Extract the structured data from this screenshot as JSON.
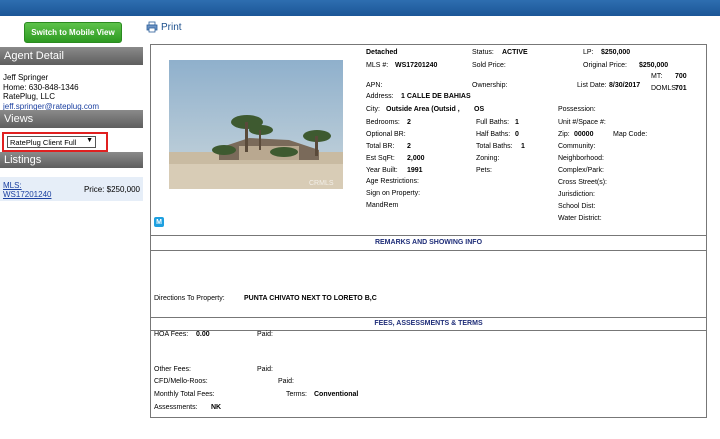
{
  "sidebar": {
    "mobile_button": "Switch to Mobile View",
    "agent_detail_title": "Agent Detail",
    "agent_name": "Jeff Springer",
    "agent_phone": "Home: 630-848-1346",
    "agent_company": "RatePlug, LLC",
    "agent_email": "jeff.springer@rateplug.com",
    "views_title": "Views",
    "views_selected": "RatePlug Client Full",
    "listings_title": "Listings",
    "listing_mls_label": "MLS:",
    "listing_mls": "WS17201240",
    "listing_price": "Price: $250,000"
  },
  "toolbar": {
    "print_label": "Print"
  },
  "listing": {
    "type": "Detached",
    "mls_label": "MLS #:",
    "mls": "WS17201240",
    "status_label": "Status:",
    "status": "ACTIVE",
    "lp_label": "LP:",
    "lp": "$250,000",
    "sold_price_label": "Sold Price:",
    "original_price_label": "Original Price:",
    "original_price": "$250,000",
    "mt_label": "MT:",
    "mt": "700",
    "apn_label": "APN:",
    "ownership_label": "Ownership:",
    "list_date_label": "List Date:",
    "list_date": "8/30/2017",
    "doml_label": "DOMLS:",
    "doml": "701",
    "address_label": "Address:",
    "address": "1 CALLE DE BAHIAS",
    "city_label": "City:",
    "city": "Outside Area (Outsid ,",
    "state": "OS",
    "possession_label": "Possession:",
    "bedrooms_label": "Bedrooms:",
    "bedrooms": "2",
    "full_baths_label": "Full Baths:",
    "full_baths": "1",
    "unit_label": "Unit #/Space #:",
    "optional_br_label": "Optional BR:",
    "half_baths_label": "Half Baths:",
    "half_baths": "0",
    "zip_label": "Zip:",
    "zip": "00000",
    "map_code_label": "Map Code:",
    "total_br_label": "Total BR:",
    "total_br": "2",
    "total_baths_label": "Total Baths:",
    "total_baths": "1",
    "community_label": "Community:",
    "est_sqft_label": "Est SqFt:",
    "est_sqft": "2,000",
    "zoning_label": "Zoning:",
    "neighborhood_label": "Neighborhood:",
    "year_built_label": "Year Built:",
    "year_built": "1991",
    "pets_label": "Pets:",
    "complex_label": "Complex/Park:",
    "age_restrictions_label": "Age Restrictions:",
    "cross_streets_label": "Cross Street(s):",
    "sign_label": "Sign on Property:",
    "jurisdiction_label": "Jurisdiction:",
    "mandrem_label": "MandRem",
    "school_dist_label": "School Dist:",
    "water_dist_label": "Water District:",
    "photo_watermark": "CRMLS"
  },
  "remarks": {
    "title": "REMARKS AND SHOWING INFO",
    "directions_label": "Directions To Property:",
    "directions": "PUNTA CHIVATO NEXT TO LORETO B,C"
  },
  "fees": {
    "title": "FEES, ASSESSMENTS & TERMS",
    "hoa_label": "HOA Fees:",
    "hoa": "0.00",
    "paid_label": "Paid:",
    "other_fees_label": "Other Fees:",
    "cfd_label": "CFD/Mello-Roos:",
    "monthly_total_label": "Monthly Total Fees:",
    "terms_label": "Terms:",
    "terms": "Conventional",
    "assessments_label": "Assessments:",
    "assessments": "NK"
  },
  "colors": {
    "topbar": "#1b5697",
    "mobile_button": "#3aa82c",
    "highlight": "#e02020",
    "link": "#1a3fa0"
  }
}
